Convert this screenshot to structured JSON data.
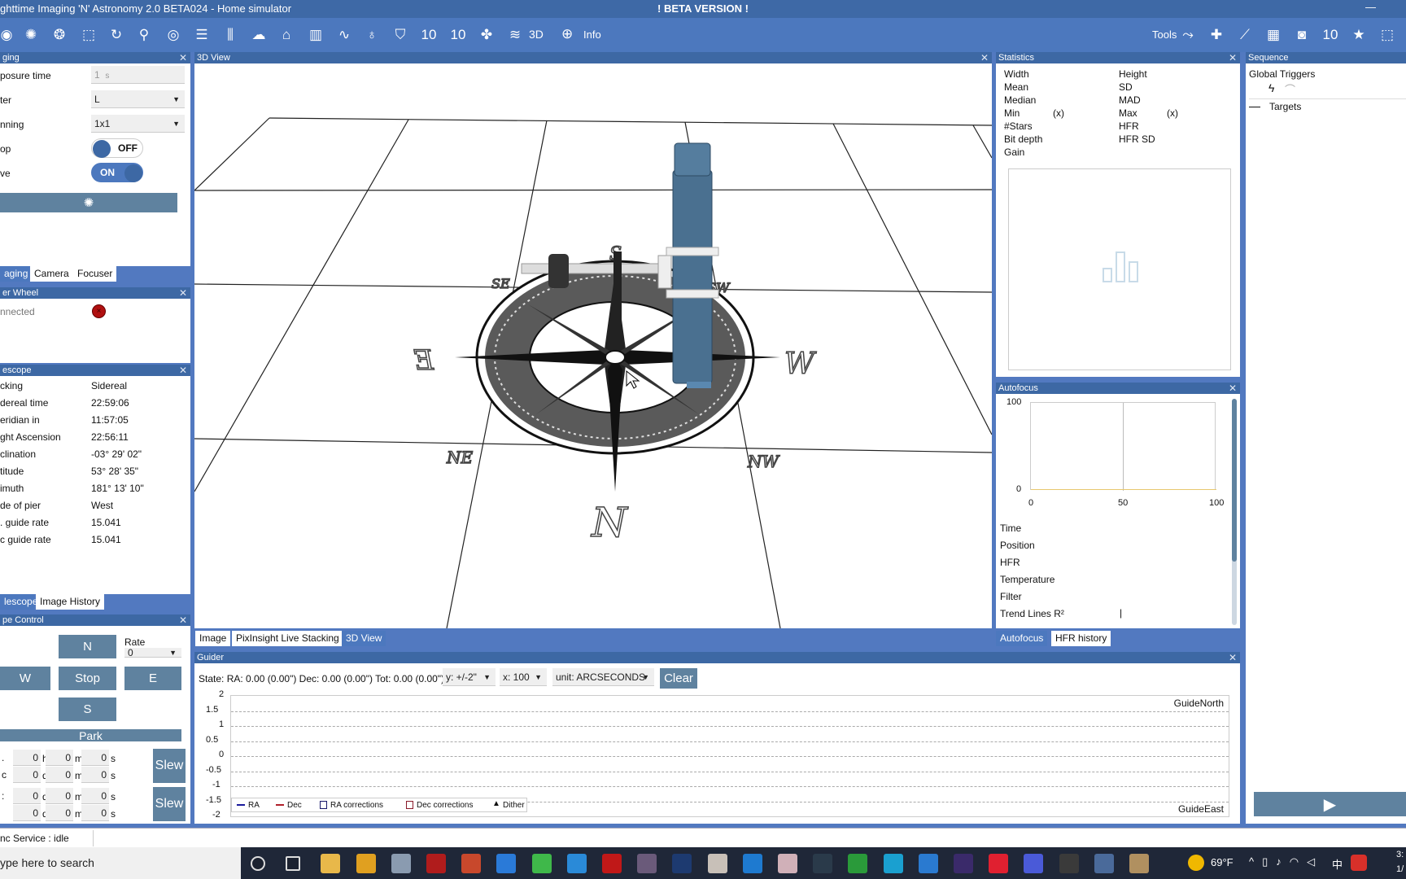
{
  "window": {
    "title": "ghttime Imaging 'N' Astronomy 2.0 BETA024 -  Home simulator",
    "beta": "! BETA VERSION !",
    "minimize": "—"
  },
  "toolbar": {
    "icons": [
      "camera-icon",
      "aperture-icon",
      "filter-wheel-icon",
      "focus-frame-icon",
      "rotator-icon",
      "telescope-icon",
      "guider-icon",
      "sequence-list-icon",
      "equipment-sliders-icon",
      "weather-cloud-icon",
      "dome-icon",
      "statistics-bars-icon",
      "hfr-graph-icon",
      "bulb-icon",
      "shield-icon",
      "ten-micron-icon",
      "ten-micron-2-icon",
      "plugin-puzzle-icon",
      "layers-icon"
    ],
    "label_3d": "3D",
    "info": "Info",
    "tools": "Tools",
    "tool_icons": [
      "polar-align-icon",
      "crosshair-icon",
      "wand-icon",
      "calculator-icon",
      "frame-icon",
      "ten-micron-tool-icon",
      "star-icon",
      "autofocus-frame-icon"
    ]
  },
  "imaging": {
    "title": "ging",
    "rows": [
      {
        "label": "posure time"
      },
      {
        "label": "ter"
      },
      {
        "label": "nning"
      },
      {
        "label": "op"
      },
      {
        "label": "ve"
      }
    ],
    "exposure": "1",
    "exposure_unit": "s",
    "filter": "L",
    "binning": "1x1",
    "loop": "OFF",
    "live": "ON",
    "tabs": [
      "aging",
      "Camera",
      "Focuser"
    ]
  },
  "filter_wheel": {
    "title": "er Wheel",
    "status": "nnected"
  },
  "telescope": {
    "title": "escope",
    "rows": [
      [
        "cking",
        "Sidereal"
      ],
      [
        "dereal time",
        "22:59:06"
      ],
      [
        "eridian in",
        "11:57:05"
      ],
      [
        "ght Ascension",
        "22:56:11"
      ],
      [
        "clination",
        "-03° 29' 02\""
      ],
      [
        "titude",
        "53° 28' 35\""
      ],
      [
        "imuth",
        "181° 13' 10\""
      ],
      [
        "de of pier",
        "West"
      ],
      [
        ". guide rate",
        "15.041"
      ],
      [
        "c guide rate",
        "15.041"
      ]
    ],
    "tabs": [
      "lescope",
      "Image History"
    ]
  },
  "telescope_control": {
    "title": "pe Control",
    "north": "N",
    "west": "W",
    "stop": "Stop",
    "east": "E",
    "south": "S",
    "rate_label": "Rate",
    "rate_value": "0",
    "park": "Park",
    "slew": "Slew",
    "coords": [
      {
        "label": ".",
        "v": [
          "0",
          "0",
          "0"
        ],
        "u": [
          "h",
          "m",
          "s"
        ]
      },
      {
        "label": "c",
        "v": [
          "0",
          "0",
          "0"
        ],
        "u": [
          "d",
          "m",
          "s"
        ]
      },
      {
        "label": ":",
        "v": [
          "0",
          "0",
          "0"
        ],
        "u": [
          "d",
          "m",
          "s"
        ]
      },
      {
        "label": "",
        "v": [
          "0",
          "0",
          "0"
        ],
        "u": [
          "d",
          "m",
          "s"
        ]
      }
    ]
  },
  "view3d": {
    "title": "3D View",
    "compass": {
      "N": "N",
      "E": "E",
      "S": "S",
      "W": "W",
      "NE": "NE",
      "NW": "NW",
      "SE": "SE",
      "SW": "SW"
    },
    "tabs": [
      "Image",
      "PixInsight Live Stacking",
      "3D View"
    ]
  },
  "statistics": {
    "title": "Statistics",
    "left": [
      "Width",
      "Mean",
      "Median",
      "Min",
      "#Stars",
      "Bit depth",
      "Gain"
    ],
    "right": [
      "Height",
      "SD",
      "MAD",
      "Max",
      "HFR",
      "HFR SD"
    ],
    "x_marker": "(x)"
  },
  "autofocus": {
    "title": "Autofocus",
    "y_ticks": [
      "100",
      "0"
    ],
    "x_ticks": [
      "0",
      "50",
      "100"
    ],
    "rows": [
      "Time",
      "Position",
      "HFR",
      "Temperature",
      "Filter",
      "Trend Lines R²"
    ],
    "cursor": "|",
    "tabs": [
      "Autofocus",
      "HFR history"
    ]
  },
  "sequence": {
    "title": "Sequence",
    "global_triggers": "Global Triggers",
    "targets": "Targets",
    "play": "play-icon"
  },
  "guider": {
    "title": "Guider",
    "state": "State:  RA: 0.00 (0.00\")  Dec: 0.00 (0.00\")  Tot: 0.00 (0.00\")",
    "y_select": "y: +/-2\"",
    "x_select": "x: 100",
    "unit_select": "unit: ARCSECONDS",
    "clear": "Clear",
    "y_ticks": [
      "2",
      "1.5",
      "1",
      "0.5",
      "0",
      "-0.5",
      "-1",
      "-1.5",
      "-2"
    ],
    "north_label": "GuideNorth",
    "east_label": "GuideEast",
    "legend": [
      "RA",
      "Dec",
      "RA corrections",
      "Dec corrections",
      "Dither"
    ],
    "colors": {
      "ra": "#1a1a9c",
      "dec": "#b0202a"
    }
  },
  "status": {
    "text": "nc Service :  idle"
  },
  "taskbar": {
    "search": "ype here to search",
    "temp": "69°F",
    "ime": "中",
    "clock1": "3:",
    "clock2": "1/",
    "apps": [
      {
        "n": "cortana-icon",
        "c": "#1c2230"
      },
      {
        "n": "task-view-icon",
        "c": "#1c2230"
      },
      {
        "n": "file-explorer-icon",
        "c": "#e8b84a"
      },
      {
        "n": "chrome-icon",
        "c": "#e0a020"
      },
      {
        "n": "app-icon",
        "c": "#8a9bb0"
      },
      {
        "n": "filezilla-icon",
        "c": "#b01c1c"
      },
      {
        "n": "app-red-icon",
        "c": "#c8482c"
      },
      {
        "n": "vs-icon",
        "c": "#2a7ad8"
      },
      {
        "n": "wechat-icon",
        "c": "#3fb84a"
      },
      {
        "n": "ie-icon",
        "c": "#2a8ad8"
      },
      {
        "n": "flash-icon",
        "c": "#c01818"
      },
      {
        "n": "app-icon",
        "c": "#6a5a7a"
      },
      {
        "n": "photoshop-icon",
        "c": "#1d3a70"
      },
      {
        "n": "app-icon",
        "c": "#c8c0b8"
      },
      {
        "n": "teamviewer-icon",
        "c": "#1e7ad0"
      },
      {
        "n": "app-icon",
        "c": "#d0b0b8"
      },
      {
        "n": "lightroom-icon",
        "c": "#2a3a4a"
      },
      {
        "n": "app-green-icon",
        "c": "#2a9a3a"
      },
      {
        "n": "edge-icon",
        "c": "#1aa0d0"
      },
      {
        "n": "mail-icon",
        "c": "#2a7ad0"
      },
      {
        "n": "stellarium-icon",
        "c": "#3a2a6a"
      },
      {
        "n": "anydesk-icon",
        "c": "#e02030"
      },
      {
        "n": "app-blue-icon",
        "c": "#4a5ad8"
      },
      {
        "n": "obs-icon",
        "c": "#3a3a3a"
      },
      {
        "n": "nina-icon",
        "c": "#4a6a9a"
      },
      {
        "n": "app-icon",
        "c": "#b09060"
      }
    ]
  }
}
